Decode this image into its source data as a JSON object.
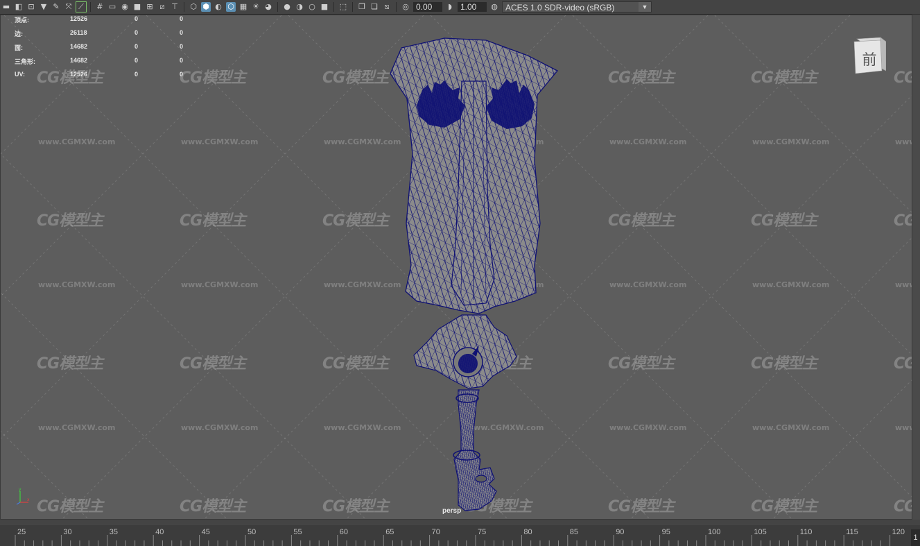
{
  "toolbar": {
    "exposure_value": "0.00",
    "gamma_value": "1.00",
    "color_management_value": "ACES 1.0 SDR-video (sRGB)"
  },
  "hud": {
    "rows": [
      {
        "label": "顶点:",
        "v1": "12526",
        "v2": "0",
        "v3": "0"
      },
      {
        "label": "边:",
        "v1": "26118",
        "v2": "0",
        "v3": "0"
      },
      {
        "label": "面:",
        "v1": "14682",
        "v2": "0",
        "v3": "0"
      },
      {
        "label": "三角形:",
        "v1": "14682",
        "v2": "0",
        "v3": "0"
      },
      {
        "label": "UV:",
        "v1": "12526",
        "v2": "0",
        "v3": "0"
      }
    ]
  },
  "viewcube": {
    "face_label": "前"
  },
  "camera_label": "persp",
  "watermark": {
    "logo": "CG模型主",
    "url": "www.CGMXW.com"
  },
  "timeline": {
    "ticks": [
      "25",
      "30",
      "35",
      "40",
      "45",
      "50",
      "55",
      "60",
      "65",
      "70",
      "75",
      "80",
      "85",
      "90",
      "95",
      "100",
      "105",
      "110",
      "115",
      "120"
    ],
    "current_frame": "1"
  },
  "colors": {
    "wireframe": "#0f1173",
    "viewport_bg": "#5d5d5d",
    "toolbar_bg": "#444444"
  }
}
